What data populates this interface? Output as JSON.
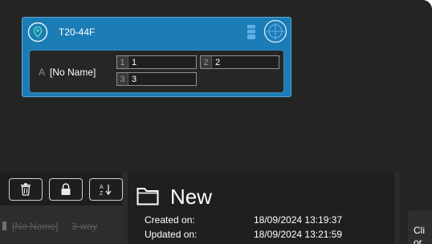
{
  "device_card": {
    "title": "T20-44F",
    "zone_letter": "A",
    "zone_name": "[No Name]",
    "channels": [
      {
        "index": "1",
        "label": "1"
      },
      {
        "index": "2",
        "label": "2"
      },
      {
        "index": "3",
        "label": "3"
      }
    ],
    "accent_color": "#1c7cb5",
    "status_color": "#4fd1b3"
  },
  "toolbar": {
    "delete_icon": "trash-icon",
    "lock_icon": "lock-icon",
    "sort_icon": "sort-az-icon"
  },
  "zone_list": {
    "items": [
      {
        "name": "[No Name]",
        "type": "3-way"
      }
    ]
  },
  "folder": {
    "title": "New",
    "created_label": "Created on:",
    "created_value": "18/09/2024 13:19:37",
    "updated_label": "Updated on:",
    "updated_value": "18/09/2024 13:21:59"
  },
  "right_panel": {
    "text_line1": "Cli",
    "text_line2": "or"
  }
}
